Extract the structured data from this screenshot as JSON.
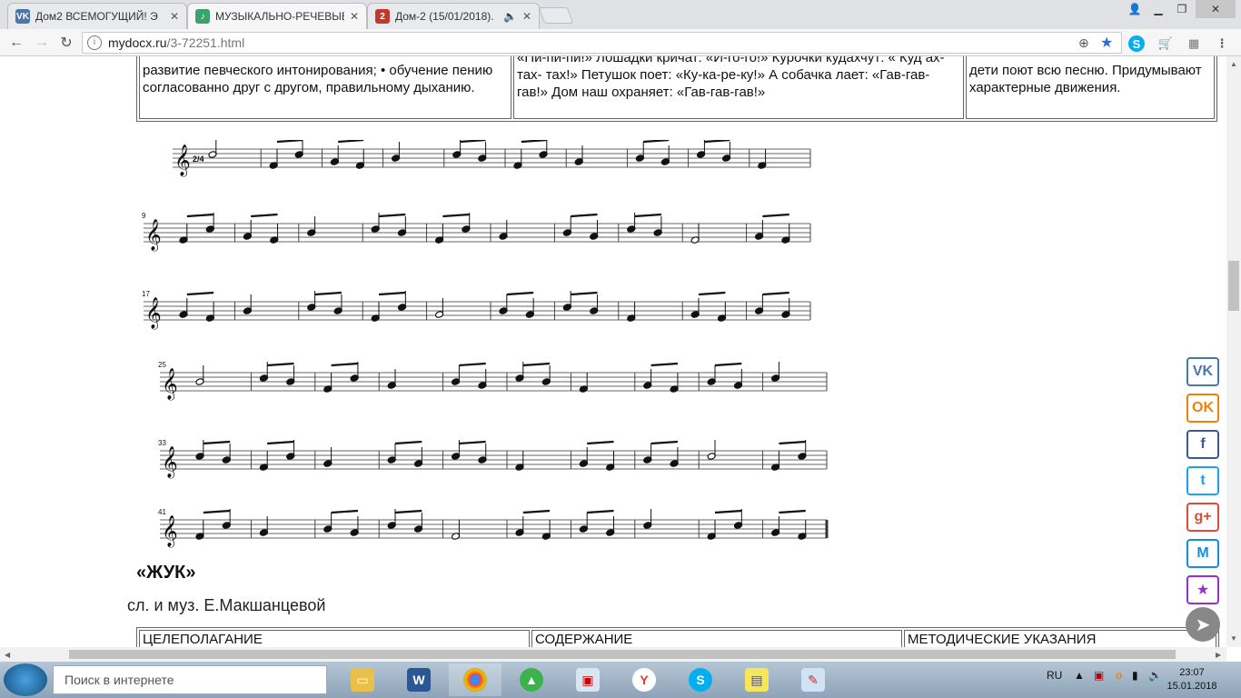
{
  "tabs": [
    {
      "label": "Дом2 ВСЕМОГУЩИЙ! Э",
      "icon": "vk-icon"
    },
    {
      "label": "МУЗЫКАЛЬНО-РЕЧЕВЫЕ",
      "icon": "page-icon"
    },
    {
      "label": "Дом-2 (15/01/2018).",
      "icon": "dom2-icon"
    }
  ],
  "address": {
    "host": "mydocx.ru",
    "path": "/3-72251.html"
  },
  "table1": {
    "col1": "развитие певческого интонирования; • обучение пению согласованно друг с другом, правильному дыханию.",
    "col2": "«Пи-пи-пи!» Лошадки кричат: «И-го-го!» Курочки кудахчут: « Куд ах- тах- тах!» Петушок поет: «Ку-ка-ре-ку!» А собачка лает: «Гав-гав-гав!» Дом наш охраняет: «Гав-гав-гав!»",
    "col3": "дети поют всю песню. Придумывают характерные движения."
  },
  "score": {
    "time_signature": "2/4",
    "measure_numbers": [
      "9",
      "17",
      "25",
      "33",
      "41"
    ]
  },
  "song": {
    "title": "«ЖУК»",
    "credit": "сл. и муз. Е.Макшанцевой"
  },
  "table2": {
    "headers": [
      "ЦЕЛЕПОЛАГАНИЕ",
      "СОДЕРЖАНИЕ",
      "МЕТОДИЧЕСКИЕ УКАЗАНИЯ"
    ]
  },
  "social": [
    {
      "label": "VK",
      "color": "#4a76a8"
    },
    {
      "label": "OK",
      "color": "#ee8208"
    },
    {
      "label": "f",
      "color": "#3b5998"
    },
    {
      "label": "t",
      "color": "#1da1f2"
    },
    {
      "label": "g+",
      "color": "#dd4b39"
    },
    {
      "label": "M",
      "color": "#168de2"
    },
    {
      "label": "★",
      "color": "#9b30c8"
    }
  ],
  "taskbar": {
    "search_placeholder": "Поиск в интернете",
    "lang": "RU",
    "time": "23:07",
    "date": "15.01.2018"
  }
}
